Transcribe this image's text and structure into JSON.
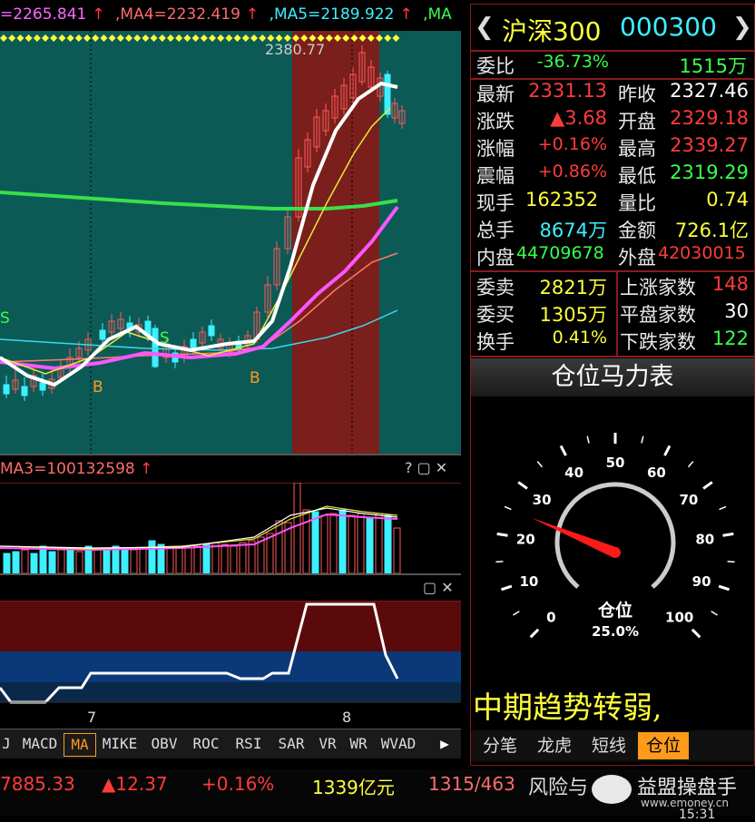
{
  "ma_header": {
    "ma3": "=2265.841",
    "ma4": ",MA4=2232.419",
    "ma5": ",MA5=2189.922",
    "ma6": ",MA",
    "peak": "2380.77"
  },
  "volume_header": {
    "label": "MA3=100132598"
  },
  "kline_markers": {
    "b1": "B",
    "b2": "B",
    "s1": "S",
    "s2": "S"
  },
  "date_ticks": {
    "t7": "7",
    "t8": "8"
  },
  "indicator_tabs": [
    "J",
    "MACD",
    "MA",
    "MIKE",
    "OBV",
    "ROC",
    "RSI",
    "SAR",
    "VR",
    "WR",
    "WVAD"
  ],
  "indicator_active": "MA",
  "quote": {
    "name": "沪深300",
    "code": "000300",
    "weibi_label": "委比",
    "weibi": "-36.73%",
    "weicha": "1515万",
    "zuixin_label": "最新",
    "zuixin": "2331.13",
    "zuoshou_label": "昨收",
    "zuoshou": "2327.46",
    "zhangdie_label": "涨跌",
    "zhangdie": "▲3.68",
    "kaipan_label": "开盘",
    "kaipan": "2329.18",
    "zhangfu_label": "涨幅",
    "zhangfu": "+0.16%",
    "zuigao_label": "最高",
    "zuigao": "2339.27",
    "zhenfu_label": "震幅",
    "zhenfu": "+0.86%",
    "zuidi_label": "最低",
    "zuidi": "2319.29",
    "xianshou_label": "现手",
    "xianshou": "162352",
    "liangbi_label": "量比",
    "liangbi": "0.74",
    "zongshou_label": "总手",
    "zongshou": "8674万",
    "jine_label": "金额",
    "jine": "726.1亿",
    "neipan_label": "内盘",
    "neipan": "44709678",
    "waipan_label": "外盘",
    "waipan": "42030015",
    "weimai_label": "委卖",
    "weimai": "2821万",
    "shangzhang_label": "上涨家数",
    "shangzhang": "148",
    "weimai2_label": "委买",
    "weimai2": "1305万",
    "pingpan_label": "平盘家数",
    "pingpan": "30",
    "huanshou_label": "换手",
    "huanshou": "0.41%",
    "xiadie_label": "下跌家数",
    "xiadie": "122"
  },
  "gauge": {
    "title": "仓位马力表",
    "center_label": "仓位",
    "percent": "25.0%",
    "level": 25,
    "ticks": [
      "0",
      "10",
      "20",
      "30",
      "40",
      "50",
      "60",
      "70",
      "80",
      "90",
      "100"
    ]
  },
  "trend_text": "中期趋势转弱,",
  "right_tabs": [
    "分笔",
    "龙虎",
    "短线",
    "仓位"
  ],
  "right_tab_active": "仓位",
  "status": {
    "index": "7885.33",
    "change": "▲12.37",
    "pct": "+0.16%",
    "amount": "1339亿元",
    "updown": "1315/463",
    "risk": "风险与",
    "brand": "益盟操盘手",
    "url": "www.emoney.cn",
    "time": "15:31"
  },
  "colors": {
    "accent_red": "#ff3b3b",
    "accent_green": "#38ff4a",
    "accent_yellow": "#ffff3c",
    "chart_bg": "#0c5a56"
  }
}
